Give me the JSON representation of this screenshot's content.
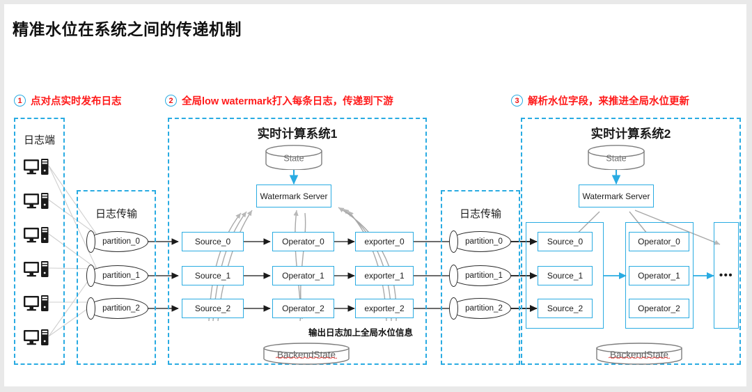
{
  "title": "精准水位在系统之间的传递机制",
  "steps": [
    {
      "num": "1",
      "label": "点对点实时发布日志"
    },
    {
      "num": "2",
      "label": "全局low watermark打入每条日志，传递到下游"
    },
    {
      "num": "3",
      "label": "解析水位字段，来推进全局水位更新"
    }
  ],
  "colors": {
    "accent": "#29ABE2",
    "red": "#ff1a1a",
    "arrow": "#595959",
    "dark_arrow": "#1b1b1b",
    "cylinder_stroke": "#6b6b6b",
    "page_bg": "#ffffff",
    "frame_bg": "#e9e9e9"
  },
  "log_client": {
    "title": "日志端",
    "icon": "desktop-computer-icon",
    "count": 6
  },
  "log_transport_1": {
    "title": "日志传输",
    "partitions": [
      "partition_0",
      "partition_1",
      "partition_2"
    ]
  },
  "log_transport_2": {
    "title": "日志传输",
    "partitions": [
      "partition_0",
      "partition_1",
      "partition_2"
    ]
  },
  "system1": {
    "title": "实时计算系统1",
    "state": "State",
    "watermark_server": "Watermark Server",
    "backend_state": "BackendState",
    "note": "输出日志加上全局水位信息",
    "columns": [
      {
        "name": "source",
        "nodes": [
          "Source_0",
          "Source_1",
          "Source_2"
        ]
      },
      {
        "name": "operator",
        "nodes": [
          "Operator_0",
          "Operator_1",
          "Operator_2"
        ]
      },
      {
        "name": "exporter",
        "nodes": [
          "exporter_0",
          "exporter_1",
          "exporter_2"
        ]
      }
    ]
  },
  "system2": {
    "title": "实时计算系统2",
    "state": "State",
    "watermark_server": "Watermark Server",
    "backend_state": "BackendState",
    "ellipsis": "•••",
    "columns": [
      {
        "name": "source",
        "nodes": [
          "Source_0",
          "Source_1",
          "Source_2"
        ]
      },
      {
        "name": "operator",
        "nodes": [
          "Operator_0",
          "Operator_1",
          "Operator_2"
        ]
      }
    ]
  }
}
